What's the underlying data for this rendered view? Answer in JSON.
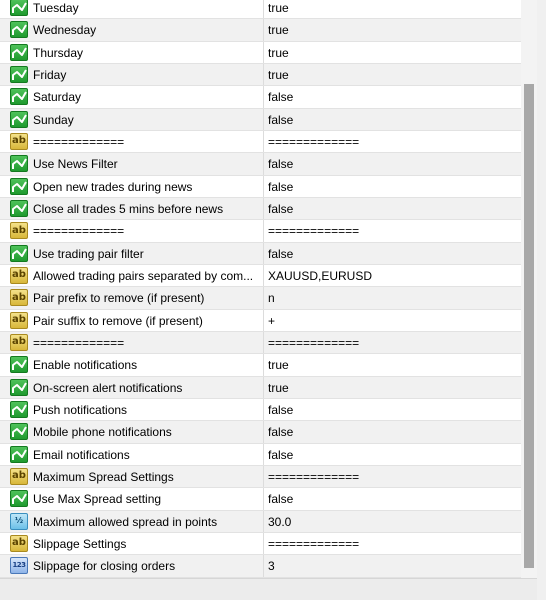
{
  "rows": [
    {
      "type": "bool",
      "name": "Tuesday",
      "value": "true"
    },
    {
      "type": "bool",
      "name": "Wednesday",
      "value": "true"
    },
    {
      "type": "bool",
      "name": "Thursday",
      "value": "true"
    },
    {
      "type": "bool",
      "name": "Friday",
      "value": "true"
    },
    {
      "type": "bool",
      "name": "Saturday",
      "value": "false"
    },
    {
      "type": "bool",
      "name": "Sunday",
      "value": "false"
    },
    {
      "type": "string",
      "name": "=============",
      "value": "============="
    },
    {
      "type": "bool",
      "name": "Use News Filter",
      "value": "false"
    },
    {
      "type": "bool",
      "name": "Open new trades during news",
      "value": "false"
    },
    {
      "type": "bool",
      "name": "Close all trades 5 mins before news",
      "value": "false"
    },
    {
      "type": "string",
      "name": "=============",
      "value": "============="
    },
    {
      "type": "bool",
      "name": "Use trading pair filter",
      "value": "false"
    },
    {
      "type": "string",
      "name": "Allowed trading pairs separated by com...",
      "value": "XAUUSD,EURUSD"
    },
    {
      "type": "string",
      "name": "Pair prefix to remove (if present)",
      "value": "n"
    },
    {
      "type": "string",
      "name": "Pair suffix to remove (if present)",
      "value": "+"
    },
    {
      "type": "string",
      "name": "=============",
      "value": "============="
    },
    {
      "type": "bool",
      "name": "Enable notifications",
      "value": "true"
    },
    {
      "type": "bool",
      "name": "On-screen alert notifications",
      "value": "true"
    },
    {
      "type": "bool",
      "name": "Push notifications",
      "value": "false"
    },
    {
      "type": "bool",
      "name": "Mobile phone notifications",
      "value": "false"
    },
    {
      "type": "bool",
      "name": "Email notifications",
      "value": "false"
    },
    {
      "type": "string",
      "name": "Maximum Spread Settings",
      "value": "============="
    },
    {
      "type": "bool",
      "name": "Use Max Spread setting",
      "value": "false"
    },
    {
      "type": "double",
      "name": "Maximum allowed spread in points",
      "value": "30.0"
    },
    {
      "type": "string",
      "name": "Slippage Settings",
      "value": "============="
    },
    {
      "type": "int",
      "name": "Slippage for closing orders",
      "value": "3"
    }
  ],
  "icons": {
    "bool": "bool-type-icon",
    "string": "string-type-icon",
    "double": "double-type-icon",
    "int": "int-type-icon"
  },
  "icon_glyphs": {
    "string": "ab",
    "double": "½",
    "int": "123"
  }
}
